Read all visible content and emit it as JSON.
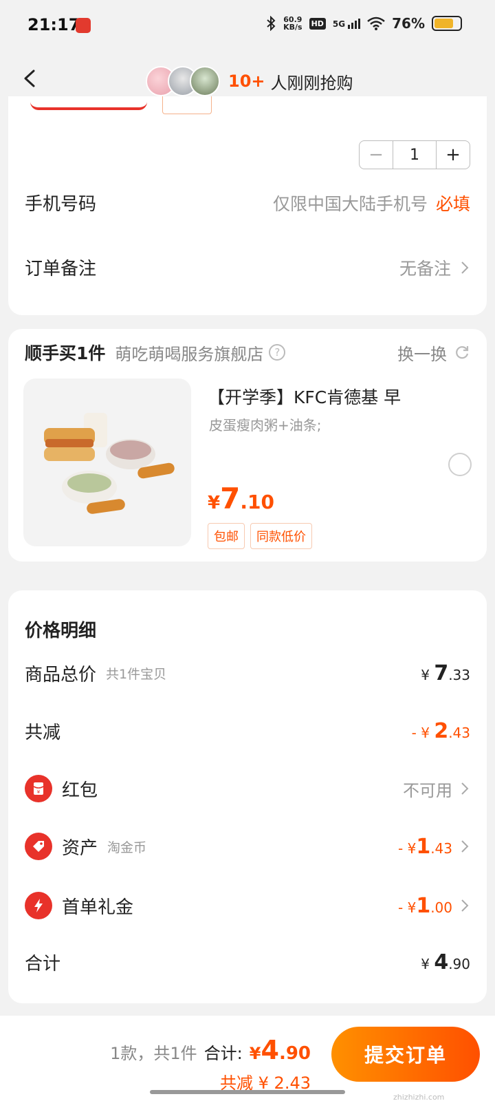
{
  "status_bar": {
    "time": "21:17",
    "net_speed": "60.9",
    "net_unit": "KB/s",
    "hd": "HD",
    "signal": "5G",
    "battery_pct": "76%",
    "battery_level": 0.76
  },
  "nav": {
    "buyers_count": "10+",
    "buyers_text": "人刚刚抢购"
  },
  "order": {
    "quantity": "1",
    "phone_label": "手机号码",
    "phone_placeholder": "仅限中国大陆手机号",
    "phone_required": "必填",
    "note_label": "订单备注",
    "note_value": "无备注"
  },
  "addon": {
    "title": "顺手买1件",
    "shop": "萌吃萌喝服务旗舰店",
    "help": "?",
    "swap": "换一换",
    "product_title": "【开学季】KFC肯德基 早",
    "product_sub": "皮蛋瘦肉粥+油条;",
    "price_currency": "¥",
    "price_int": "7",
    "price_dec": ".10",
    "badges": [
      "包邮",
      "同款低价"
    ]
  },
  "price_detail": {
    "title": "价格明细",
    "goods_total_label": "商品总价",
    "goods_total_sub": "共1件宝贝",
    "goods_total_cur": "¥",
    "goods_total_int": "7",
    "goods_total_dec": ".33",
    "discount_label": "共减",
    "discount_cur": "- ¥",
    "discount_int": "2",
    "discount_dec": ".43",
    "redpacket_label": "红包",
    "redpacket_value": "不可用",
    "asset_label": "资产",
    "asset_sub": "淘金币",
    "asset_cur": "- ¥",
    "asset_int": "1",
    "asset_dec": ".43",
    "firstorder_label": "首单礼金",
    "firstorder_cur": "- ¥",
    "firstorder_int": "1",
    "firstorder_dec": ".00",
    "sum_label": "合计",
    "sum_cur": "¥",
    "sum_int": "4",
    "sum_dec": ".90"
  },
  "bottom": {
    "summary": "1款，共1件",
    "total_label": "合计:",
    "total_cur": "¥",
    "total_int": "4",
    "total_dec": ".90",
    "saved": "共减 ¥ 2.43",
    "submit": "提交订单"
  },
  "watermark": "zhizhizhi.com",
  "colors": {
    "accent": "#ff5000",
    "accent_light": "#ff9000",
    "icon_red": "#e8322a",
    "background": "#f2f2f2"
  }
}
